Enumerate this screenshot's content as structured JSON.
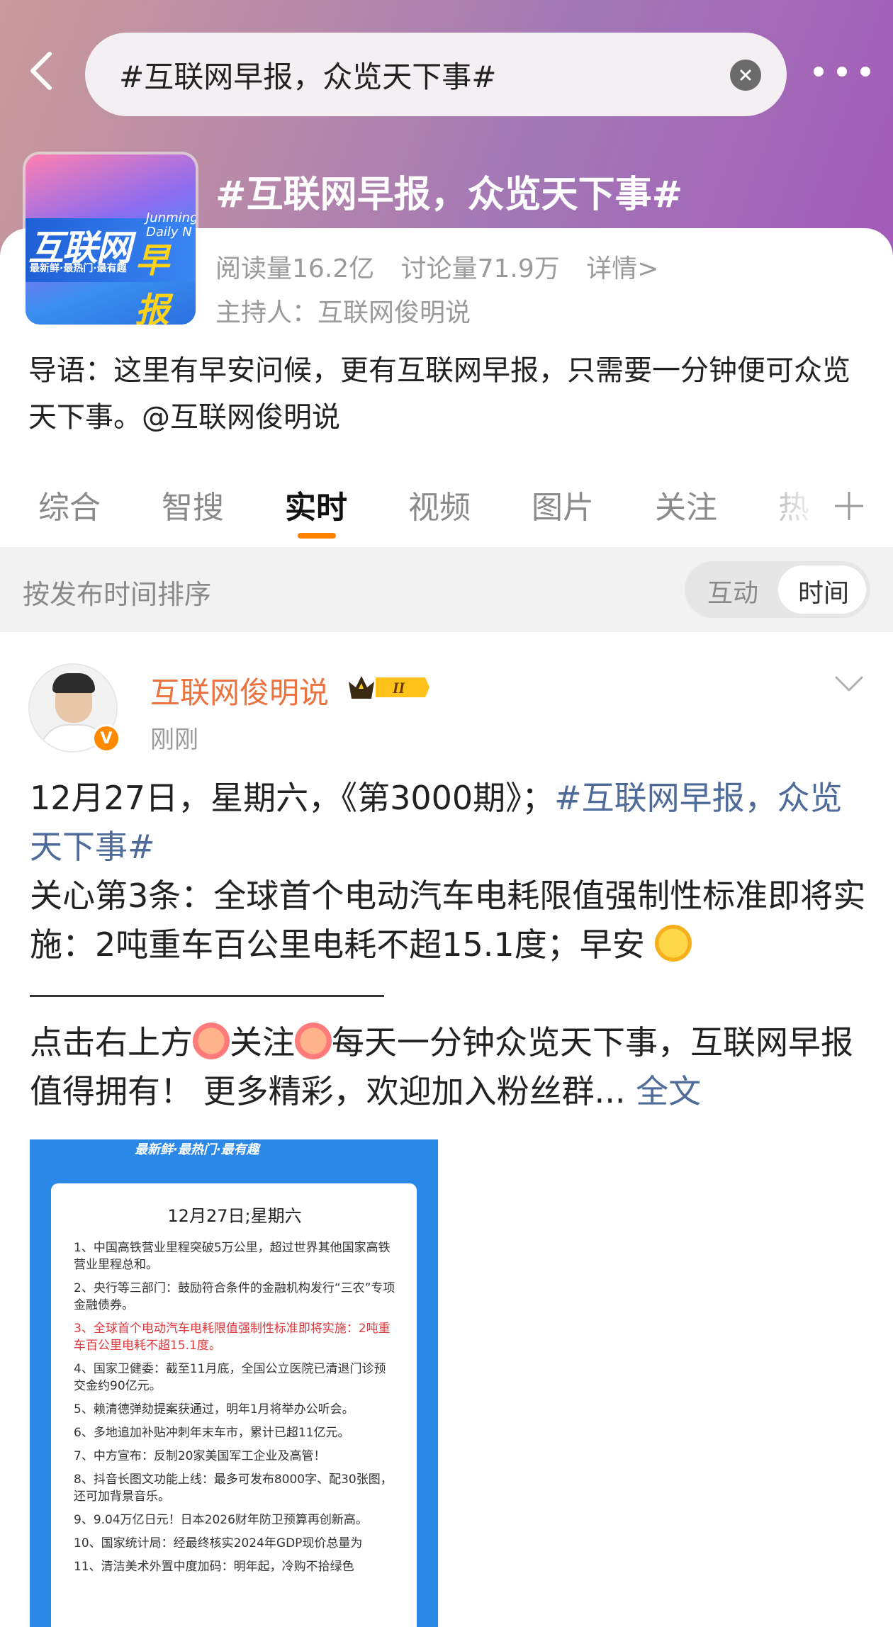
{
  "header": {
    "search_text": "#互联网早报，众览天下事#"
  },
  "topic": {
    "thumb_text": "互联网",
    "thumb_badge": "早报",
    "thumb_sub": "最新鲜·最热门·最有趣",
    "thumb_en": "Junming Daily N",
    "title": "#互联网早报，众览天下事#",
    "reads": "阅读量16.2亿",
    "discussions": "讨论量71.9万",
    "details": "详情>",
    "host": "主持人：互联网俊明说"
  },
  "intro": "导语：这里有早安问候，更有互联网早报，只需要一分钟便可众览天下事。@互联网俊明说",
  "tabs": [
    "综合",
    "智搜",
    "实时",
    "视频",
    "图片",
    "关注",
    "热"
  ],
  "sort": {
    "label": "按发布时间排序",
    "opt1": "互动",
    "opt2": "时间"
  },
  "post": {
    "author": "互联网俊明说",
    "level_badge": "II",
    "verified": "V",
    "time": "刚刚",
    "line1_prefix": "12月27日，星期六，《第3000期》；",
    "line1_tag": "#互联网早报，众览天下事#",
    "line2": "关心第3条：全球首个电动汽车电耗限值强制性标准即将实施：2吨重车百公里电耗不超15.1度；早安",
    "line3_a": "点击右上方",
    "line3_b": "关注",
    "line3_c": "每天一分钟众览天下事，互联网早报值得拥有！ 更多精彩，欢迎加入粉丝群...",
    "full_text": "全文"
  },
  "image": {
    "header": "最新鲜·最热门·最有趣",
    "date": "12月27日;星期六",
    "items": [
      "1、中国高铁营业里程突破5万公里，超过世界其他国家高铁营业里程总和。",
      "2、央行等三部门：鼓励符合条件的金融机构发行“三农”专项金融债券。",
      "3、全球首个电动汽车电耗限值强制性标准即将实施：2吨重车百公里电耗不超15.1度。",
      "4、国家卫健委：截至11月底，全国公立医院已清退门诊预交金约90亿元。",
      "5、赖清德弹劾提案获通过，明年1月将举办公听会。",
      "6、多地追加补贴冲刺年末车市，累计已超11亿元。",
      "7、中方宣布：反制20家美国军工企业及高管！",
      "8、抖音长图文功能上线：最多可发布8000字、配30张图，还可加背景音乐。",
      "9、9.04万亿日元！日本2026财年防卫预算再创新高。",
      "10、国家统计局：经最终核实2024年GDP现价总量为",
      "11、清洁美术外置中度加码：明年起，冷购不拾绿色"
    ]
  }
}
